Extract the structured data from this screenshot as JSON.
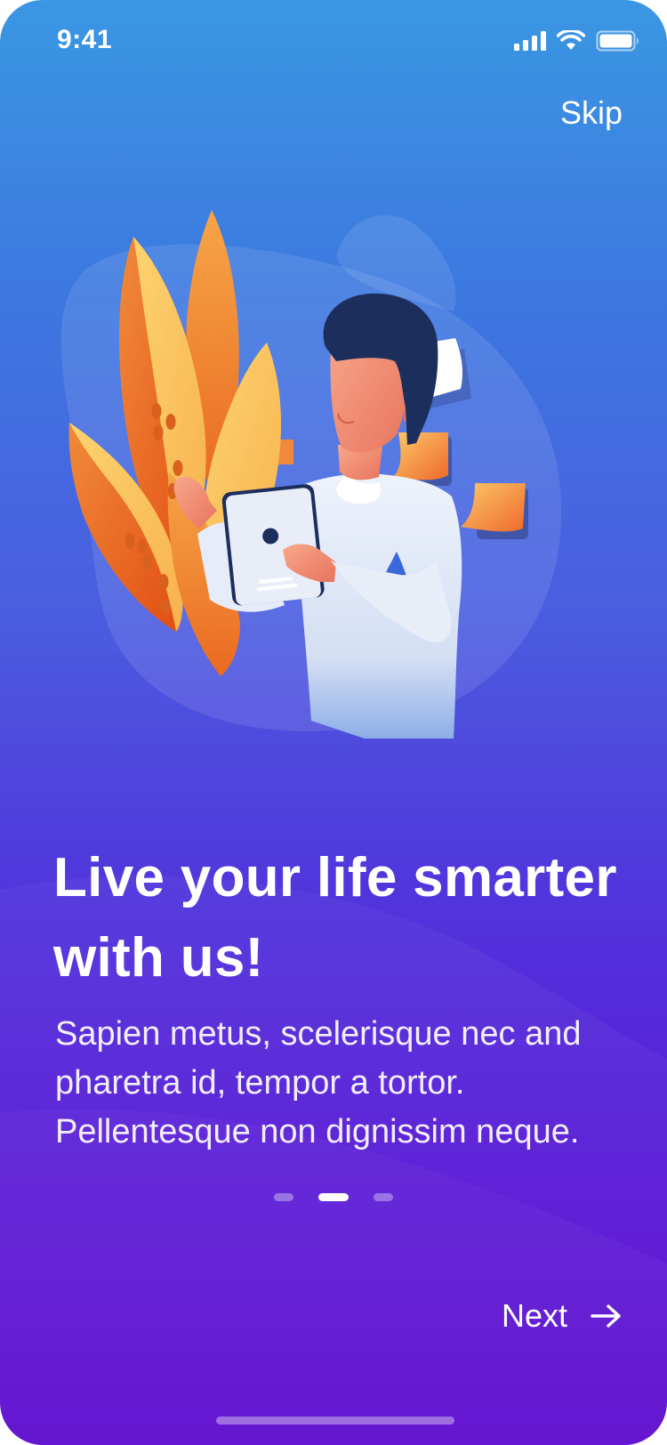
{
  "status_bar": {
    "time": "9:41"
  },
  "header": {
    "skip_label": "Skip"
  },
  "onboarding": {
    "title": "Live your life smarter with us!",
    "body": "Sapien metus, scelerisque nec and pharetra id, tempor a tortor. Pellentesque non dignissim neque.",
    "page_count": 3,
    "current_page": 2
  },
  "footer": {
    "next_label": "Next",
    "next_icon": "arrow-right-icon"
  },
  "colors": {
    "gradient_top": "#3a97e3",
    "gradient_bottom": "#5b06ce",
    "text": "#ffffff",
    "accent_orange": "#f08a3a",
    "accent_yellow": "#fcd06f"
  }
}
